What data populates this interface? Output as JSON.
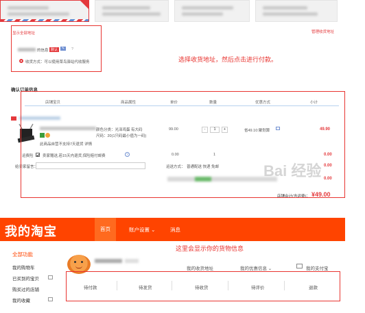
{
  "address": {
    "show_all": "显示全部地址",
    "manage": "管理收货地址",
    "recipient_suffix": "的信息",
    "default_badge": "默认",
    "question_mark": "?",
    "option_text": "收货方式：可以使用菜鸟驿站代收服务"
  },
  "annotations": {
    "select_address": "选择收货地址，然后点击进行付款。",
    "order_info_shown": "这里会显示你的货物信息"
  },
  "order": {
    "section_title": "确认订单信息",
    "headers": [
      "店铺宝贝",
      "商品属性",
      "单价",
      "数量",
      "优惠方式",
      "小计"
    ],
    "item_attr_1": "颜色分类：光泽鸡蛋 有大码",
    "item_attr_2": "尺码：20(1只码最小值为一码)",
    "item_note": "此商品自营不支持7天退货 详情",
    "unit_price": "99.00",
    "qty": "1",
    "qty_minus": "-",
    "qty_plus": "+",
    "discount": "省49.10:聚划算",
    "subtotal": "49.90",
    "service_label": "运费险",
    "service_text": "卖家赠送,若15天内退货,保险赔付邮费",
    "service_price": "0.00",
    "service_qty": "1",
    "service_subtotal": "0.00",
    "message_label": "给卖家留言：",
    "shipping_label": "运送方式：",
    "shipping_value": "普通配送 快递 免邮",
    "shipping_price": "0.00",
    "line_total": "0.00",
    "total_label": "店铺合计(含运费)：",
    "total_value": "¥49.00"
  },
  "taobao": {
    "logo": "我的淘宝",
    "nav": [
      "首页",
      "账户设置 ⌄",
      "消息"
    ],
    "sidebar_title": "全部功能",
    "sidebar": [
      "我的购物车",
      "已买到的宝贝",
      "购买过的店铺",
      "我的收藏"
    ],
    "profile_links": [
      "我的收货地址",
      "我的优惠信息 ⌄",
      "我的支付宝"
    ],
    "status": [
      "待付款",
      "待发货",
      "待收货",
      "待评价",
      "退款"
    ]
  },
  "watermark": "Bai 经验",
  "colors": {
    "accent": "#e4393c",
    "taobao_orange": "#ff4400",
    "annotation_red": "#e8332f"
  }
}
